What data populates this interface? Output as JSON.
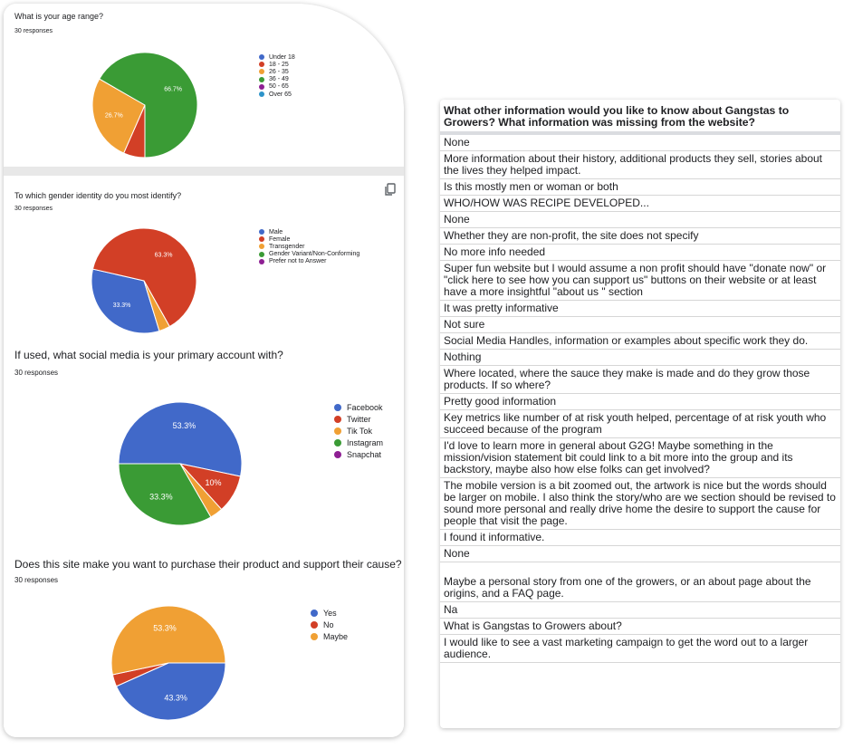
{
  "forms": {
    "q1": {
      "title": "What is your age range?",
      "responses": "30 responses",
      "legend": [
        {
          "label": "Under 18",
          "color": "#4169c9"
        },
        {
          "label": "18 - 25",
          "color": "#d23f26"
        },
        {
          "label": "26 - 35",
          "color": "#f0a034"
        },
        {
          "label": "36 - 49",
          "color": "#3a9b35"
        },
        {
          "label": "50 - 65",
          "color": "#8e1f93"
        },
        {
          "label": "Over 65",
          "color": "#2c93c9"
        }
      ]
    },
    "q2": {
      "title": "To which gender identity do you most identify?",
      "responses": "30 responses",
      "legend": [
        {
          "label": "Male",
          "color": "#4169c9"
        },
        {
          "label": "Female",
          "color": "#d23f26"
        },
        {
          "label": "Transgender",
          "color": "#f0a034"
        },
        {
          "label": "Gender Variant/Non-Conforming",
          "color": "#3a9b35"
        },
        {
          "label": "Prefer not to Answer",
          "color": "#8e1f93"
        }
      ]
    },
    "q3": {
      "title": "If used, what social media is your primary account with?",
      "responses": "30 responses",
      "legend": [
        {
          "label": "Facebook",
          "color": "#4169c9"
        },
        {
          "label": "Twitter",
          "color": "#d23f26"
        },
        {
          "label": "Tik Tok",
          "color": "#f0a034"
        },
        {
          "label": "Instagram",
          "color": "#3a9b35"
        },
        {
          "label": "Snapchat",
          "color": "#8e1f93"
        }
      ]
    },
    "q4": {
      "title": "Does this site make you want to purchase their product and support their cause?",
      "responses": "30 responses",
      "legend": [
        {
          "label": "Yes",
          "color": "#4169c9"
        },
        {
          "label": "No",
          "color": "#d23f26"
        },
        {
          "label": "Maybe",
          "color": "#f0a034"
        }
      ]
    }
  },
  "chart_data": [
    {
      "type": "pie",
      "title": "What is your age range?",
      "labels": [
        "Under 18",
        "18 - 25",
        "26 - 35",
        "36 - 49",
        "50 - 65",
        "Over 65"
      ],
      "values": [
        0,
        6.6,
        26.7,
        66.7,
        0,
        0
      ],
      "data_labels": [
        "",
        "",
        "26.7%",
        "66.7%",
        "",
        ""
      ]
    },
    {
      "type": "pie",
      "title": "To which gender identity do you most identify?",
      "labels": [
        "Male",
        "Female",
        "Transgender",
        "Gender Variant/Non-Conforming",
        "Prefer not to Answer"
      ],
      "values": [
        33.3,
        63.3,
        3.4,
        0,
        0
      ],
      "data_labels": [
        "33.3%",
        "63.3%",
        "",
        "",
        ""
      ]
    },
    {
      "type": "pie",
      "title": "If used, what social media is your primary account with?",
      "labels": [
        "Facebook",
        "Twitter",
        "Tik Tok",
        "Instagram",
        "Snapchat"
      ],
      "values": [
        53.3,
        10,
        3.4,
        33.3,
        0
      ],
      "data_labels": [
        "53.3%",
        "10%",
        "",
        "33.3%",
        ""
      ]
    },
    {
      "type": "pie",
      "title": "Does this site make you want to purchase their product and support their cause?",
      "labels": [
        "Yes",
        "No",
        "Maybe"
      ],
      "values": [
        43.3,
        3.4,
        53.3
      ],
      "data_labels": [
        "43.3%",
        "",
        "53.3%"
      ]
    }
  ],
  "table": {
    "header": "What other information would you like to know about Gangstas to Growers? What information was missing from the website?",
    "rows": [
      "None",
      "More information about their history, additional products they sell, stories about the lives they helped impact.",
      "Is this mostly men or woman or both",
      "WHO/HOW WAS RECIPE DEVELOPED...",
      "None",
      "Whether they are non-profit, the site does not specify",
      "No more info needed",
      "Super fun website but I would assume a non profit should have \"donate now\" or \"click here to see how you can support us\" buttons on their website or at least have a more insightful \"about us \" section",
      "It was pretty informative",
      "Not sure",
      "Social Media Handles, information or examples about specific work they do.",
      "Nothing",
      "Where located, where the sauce they make is made and do they grow those products. If so where?",
      "Pretty good information",
      "Key metrics like number of at risk youth helped, percentage of at risk youth who succeed because of the program",
      "I'd love to learn more in general about G2G! Maybe something in the mission/vision statement bit could link to a bit more into the group and its backstory, maybe also how else folks can get involved?",
      "The mobile version is a bit zoomed out, the artwork is nice but the words should be larger on mobile. I also think the story/who are we section should be revised to sound more personal and really drive home the desire to support the cause for people that visit the page.",
      "I found it informative.",
      "None",
      "\nMaybe a personal story from one of the growers, or an about page about the origins, and a FAQ page.",
      "Na",
      "What is Gangstas to Growers about?",
      "I would like to see a vast marketing campaign to get the word out to a larger audience."
    ]
  },
  "icons": {
    "copy": "copy-icon"
  }
}
